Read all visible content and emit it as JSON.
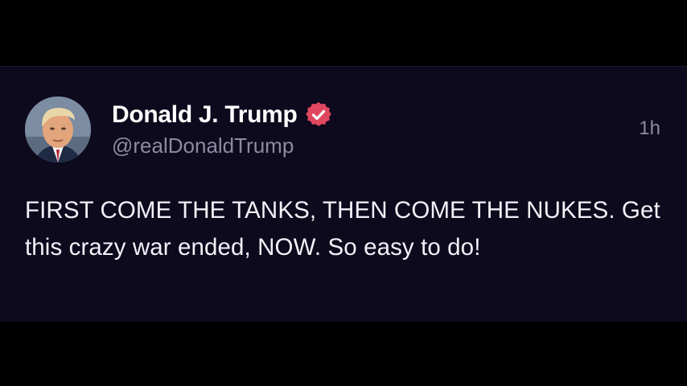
{
  "post": {
    "author": {
      "display_name": "Donald J. Trump",
      "handle": "@realDonaldTrump",
      "verified": true,
      "verified_icon": "verified-badge-icon",
      "avatar": "profile-photo"
    },
    "timestamp": "1h",
    "text": "FIRST COME THE TANKS, THEN COME THE NUKES. Get this crazy war ended, NOW. So easy to do!"
  },
  "colors": {
    "page_background": "#000000",
    "card_background": "#0c0a1c",
    "primary_text": "#ffffff",
    "secondary_text": "#8d8aa3",
    "verified_badge": "#e0475f"
  }
}
